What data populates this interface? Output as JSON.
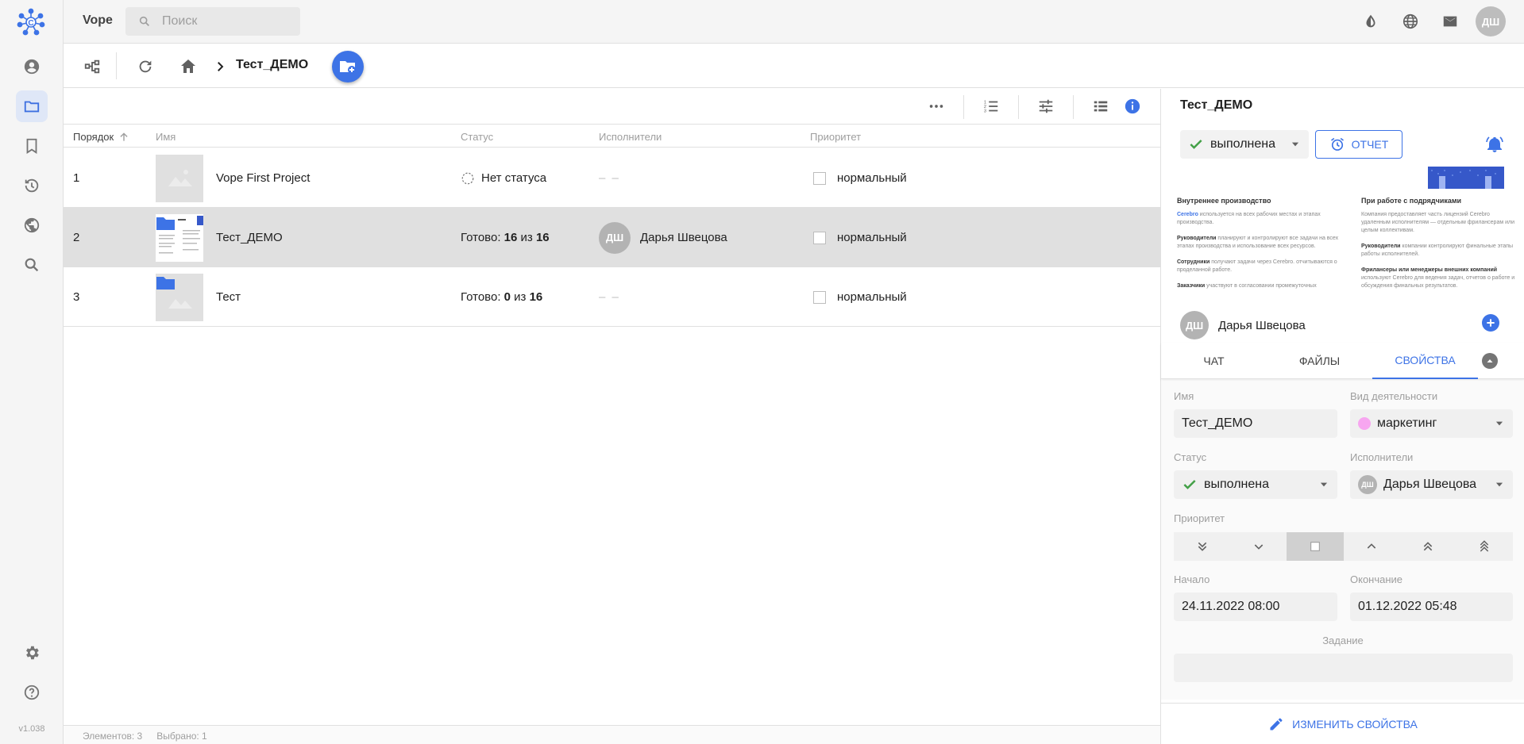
{
  "app": {
    "name": "Vope",
    "version": "v1.038",
    "search_placeholder": "Поиск",
    "user_initials": "ДШ"
  },
  "rail": {
    "items": [
      "profile",
      "folders",
      "bookmarks",
      "history",
      "globe",
      "search"
    ],
    "active": "folders"
  },
  "toolbar": {
    "breadcrumb_current": "Тест_ДЕМО"
  },
  "table": {
    "columns": {
      "order": "Порядок",
      "name": "Имя",
      "status": "Статус",
      "assignees": "Исполнители",
      "priority": "Приоритет"
    },
    "rows": [
      {
        "order": "1",
        "name": "Vope First Project",
        "status_text": "Нет статуса",
        "assignee": "– –",
        "priority": "нормальный"
      },
      {
        "order": "2",
        "name": "Тест_ДЕМО",
        "status_prefix": "Готово: ",
        "done": "16",
        "of_word": " из ",
        "total": "16",
        "assignee_initials": "ДШ",
        "assignee": "Дарья Швецова",
        "priority": "нормальный"
      },
      {
        "order": "3",
        "name": "Тест",
        "status_prefix": "Готово: ",
        "done": "0",
        "of_word": " из ",
        "total": "16",
        "assignee": "– –",
        "priority": "нормальный"
      }
    ]
  },
  "footer": {
    "elements": "Элементов: 3",
    "selected": "Выбрано: 1"
  },
  "panel": {
    "title": "Тест_ДЕМО",
    "status": "выполнена",
    "report_button": "ОТЧЕТ",
    "preview": {
      "heading_left": "Внутреннее производство",
      "heading_right": "При работе с подрядчиками",
      "para_left_1_bold": "Cerebro",
      "para_left_1": "используется на всех рабочих местах и этапах производства.",
      "para_left_2_bold": "Руководители",
      "para_left_2": "планируют и контролируют все задачи на всех этапах производства и использование всех ресурсов.",
      "para_left_3_bold": "Сотрудники",
      "para_left_3": "получают задачи через Cerebro. отчитываются о проделанной работе.",
      "para_left_4_bold": "Заказчики",
      "para_left_4": "участвуют в согласовании промежуточных",
      "para_right_1": "Компания предоставляет часть лицензий Cerebro удаленным исполнителям — отдельным фрилансерам или целым коллективам.",
      "para_right_2_bold": "Руководители",
      "para_right_2": "компании контролируют финальные этапы работы исполнителей.",
      "para_right_3_bold": "Фрилансеры или менеджеры внешних компаний",
      "para_right_3": "используют Cerebro для ведения задач, отчетов о работе и обсуждения финальных результатов."
    },
    "assignee_initials": "ДШ",
    "assignee": "Дарья Швецова",
    "tabs": [
      "ЧАТ",
      "ФАЙЛЫ",
      "СВОЙСТВА"
    ],
    "active_tab": "СВОЙСТВА",
    "props": {
      "name_label": "Имя",
      "name_value": "Тест_ДЕМО",
      "activity_label": "Вид деятельности",
      "activity_value": "маркетинг",
      "activity_color": "#f7a6f0",
      "status_label": "Статус",
      "status_value": "выполнена",
      "assignees_label": "Исполнители",
      "assignees_value": "Дарья Швецова",
      "assignees_initials": "ДШ",
      "priority_label": "Приоритет",
      "priority_selected": "normal",
      "start_label": "Начало",
      "start_value": "24.11.2022 08:00",
      "end_label": "Окончание",
      "end_value": "01.12.2022 05:48",
      "task_label": "Задание",
      "task_value": ""
    },
    "edit_button": "ИЗМЕНИТЬ СВОЙСТВА"
  },
  "colors": {
    "accent": "#3d73e6",
    "done_green": "#43a047",
    "selected_row": "#e0e0e0"
  }
}
